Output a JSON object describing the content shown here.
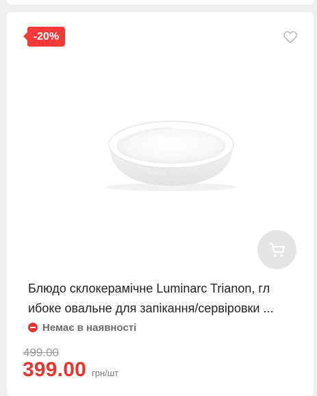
{
  "product": {
    "discount_badge": "-20%",
    "title": "Блюдо склокерамічне Luminarc Trianon, гл ибоке овальне для запікання/сервіровки ...",
    "availability": "Немає в наявності",
    "old_price": "499.00",
    "price": "399.00",
    "price_unit": "грн/шт"
  },
  "icons": {
    "wishlist": "heart-outline-icon",
    "cart": "cart-icon",
    "availability": "minus-circle-icon"
  },
  "colors": {
    "accent": "#e8332f",
    "badge": "#f23a39",
    "background": "#efefef",
    "card": "#ffffff"
  }
}
